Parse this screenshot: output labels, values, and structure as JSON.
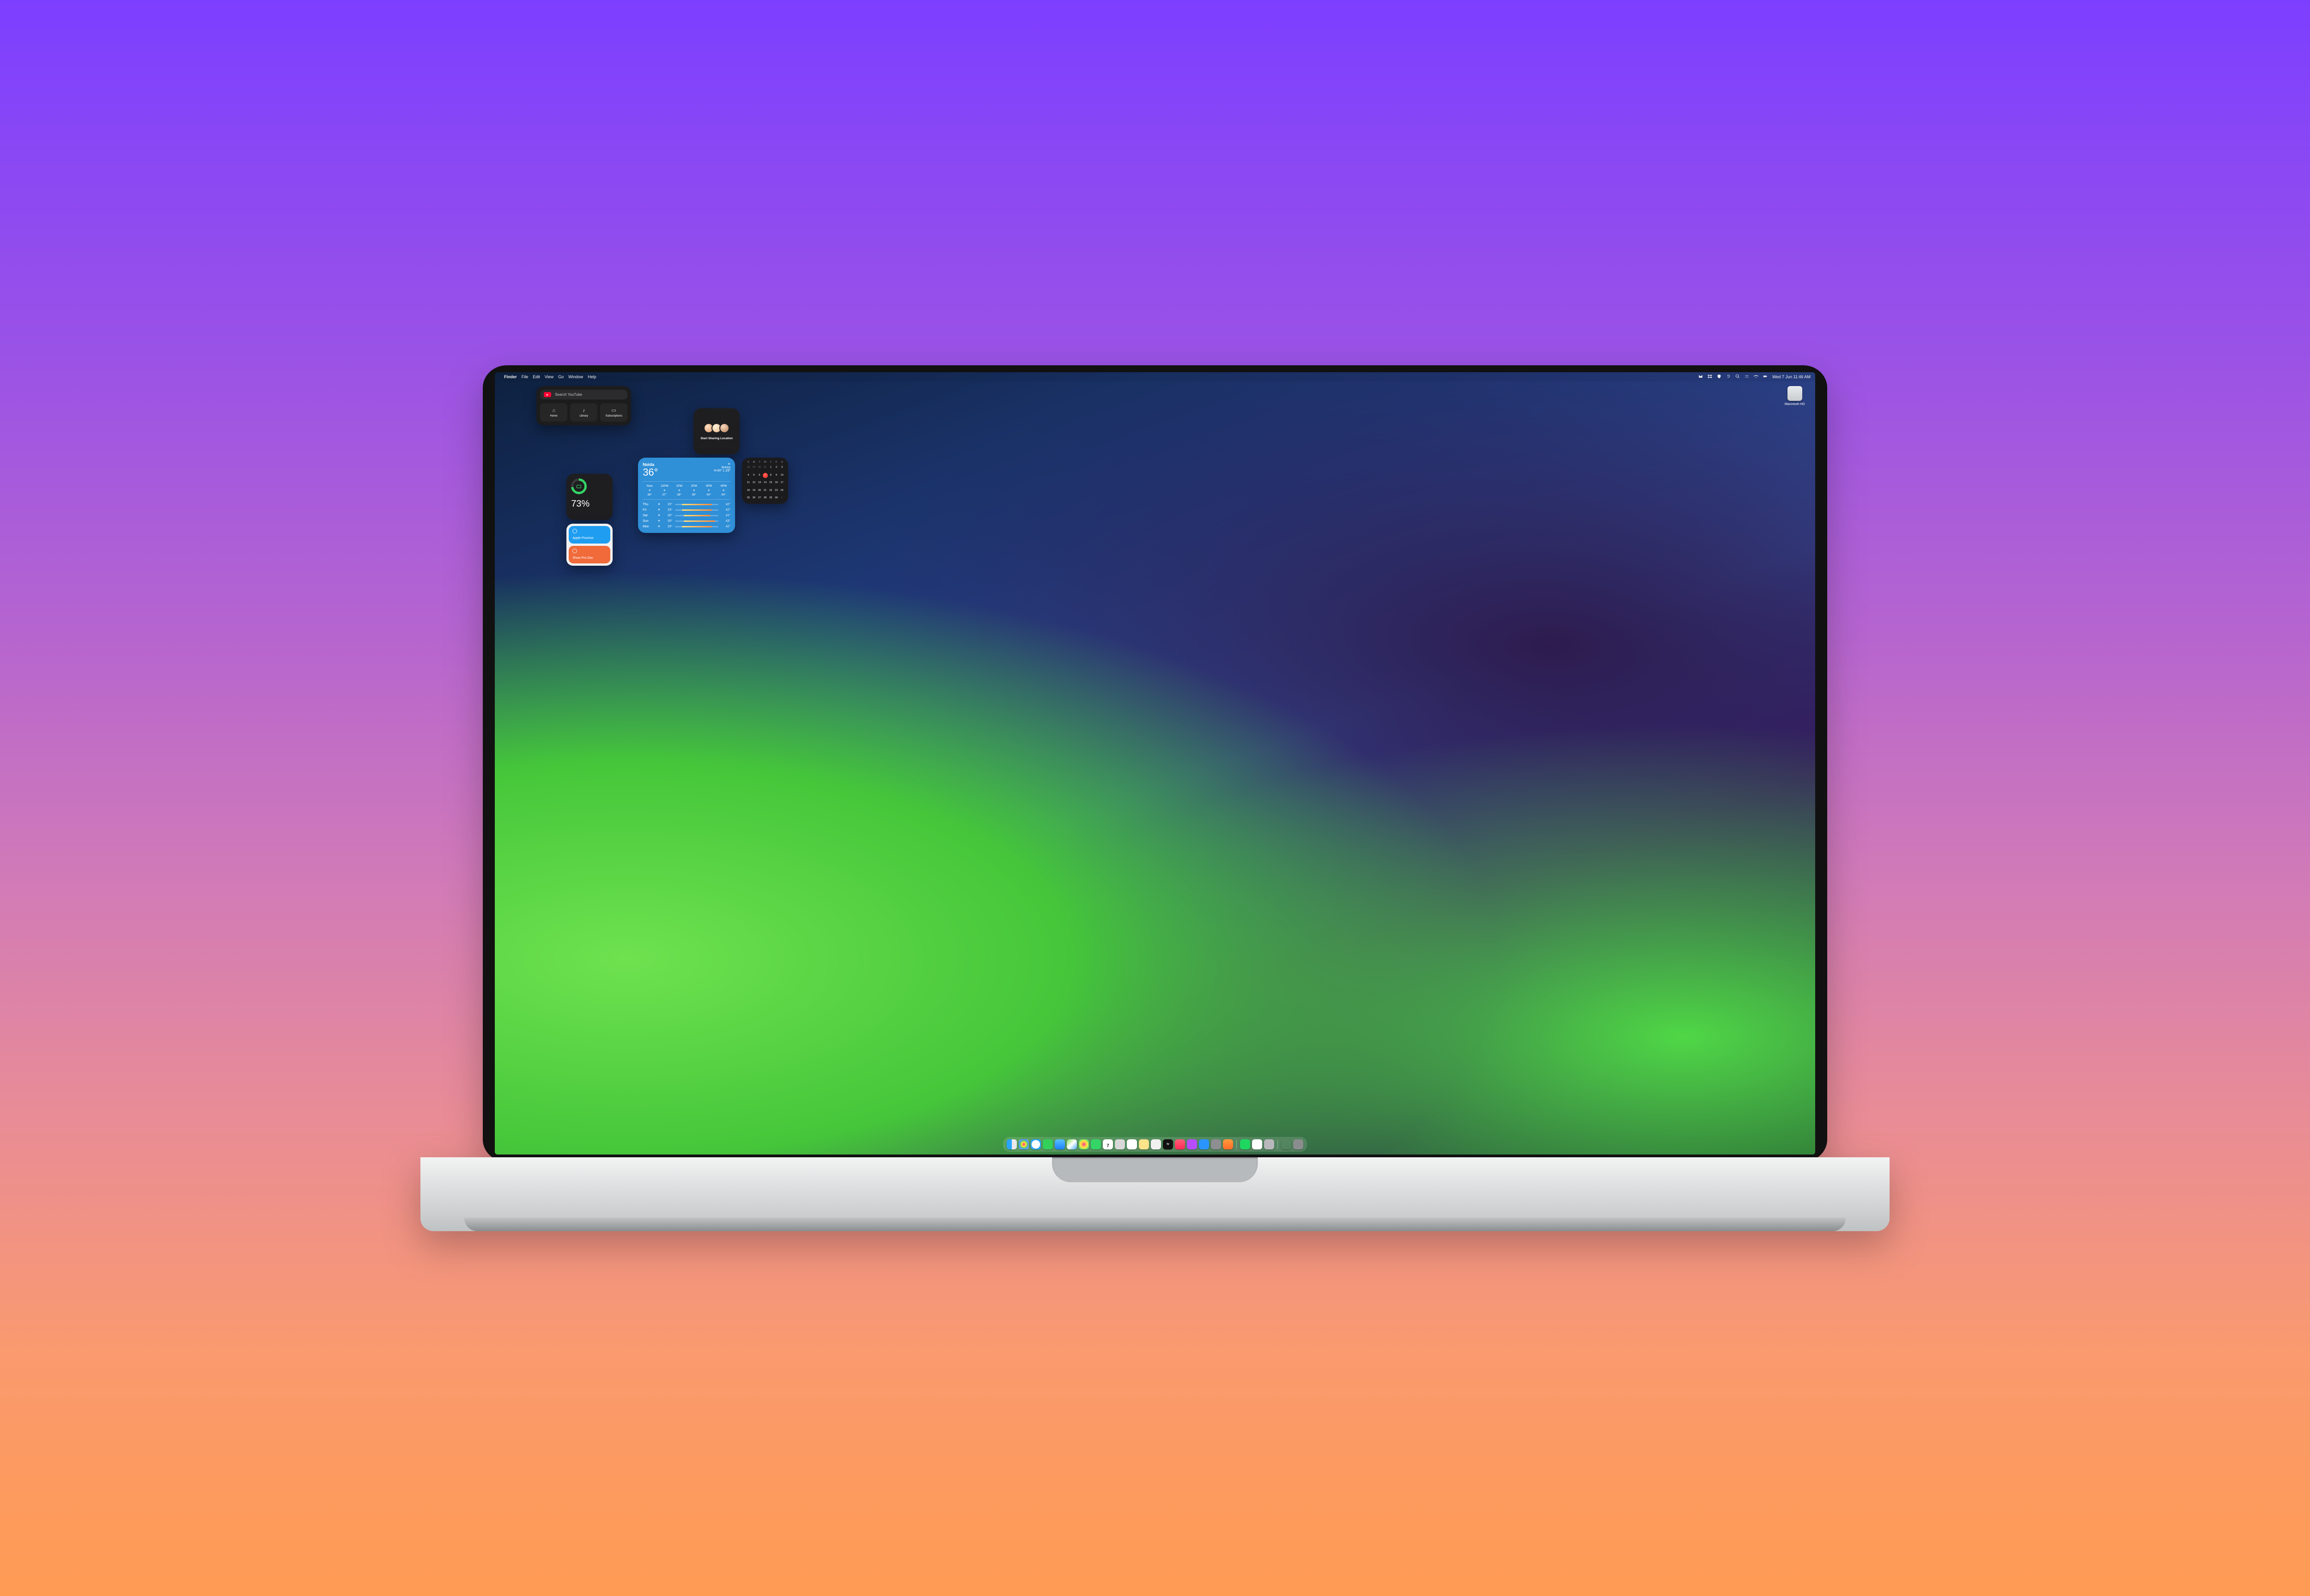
{
  "menubar": {
    "apple": "",
    "app": "Finder",
    "items": [
      "File",
      "Edit",
      "View",
      "Go",
      "Window",
      "Help"
    ],
    "right_icons": [
      "mail-icon",
      "dropbox-icon",
      "shield-icon",
      "sync-icon",
      "search-icon",
      "control-center-icon",
      "wifi-icon",
      "battery-icon"
    ],
    "clock": "Wed 7 Jun  11:46 AM"
  },
  "disk": {
    "name": "Macintosh HD"
  },
  "youtube": {
    "placeholder": "Search YouTube",
    "tiles": [
      {
        "icon": "home-icon",
        "label": "Home"
      },
      {
        "icon": "library-icon",
        "label": "Library"
      },
      {
        "icon": "subs-icon",
        "label": "Subscriptions"
      }
    ]
  },
  "findmy": {
    "label": "Start Sharing Location"
  },
  "battery": {
    "percent": "73%",
    "ring_pct": 73
  },
  "reminders": [
    {
      "color": "c-blue",
      "title": "Apple Promise"
    },
    {
      "color": "c-orange",
      "title": "Show Pro Doc"
    }
  ],
  "weather": {
    "city": "Noida",
    "temp": "36°",
    "cond": "Sunny",
    "hilo": "H:40° L:29°",
    "hourly": [
      {
        "t": "Now",
        "temp": "36°"
      },
      {
        "t": "12PM",
        "temp": "37°"
      },
      {
        "t": "1PM",
        "temp": "38°"
      },
      {
        "t": "2PM",
        "temp": "39°"
      },
      {
        "t": "3PM",
        "temp": "40°"
      },
      {
        "t": "4PM",
        "temp": "40°"
      }
    ],
    "daily": [
      {
        "d": "Thu",
        "lo": "29°",
        "hi": "42°",
        "l": 15,
        "w": 70
      },
      {
        "d": "Fri",
        "lo": "29°",
        "hi": "42°",
        "l": 15,
        "w": 70
      },
      {
        "d": "Sat",
        "lo": "30°",
        "hi": "41°",
        "l": 20,
        "w": 62
      },
      {
        "d": "Sun",
        "lo": "30°",
        "hi": "43°",
        "l": 20,
        "w": 72
      },
      {
        "d": "Mon",
        "lo": "29°",
        "hi": "42°",
        "l": 15,
        "w": 70
      }
    ]
  },
  "calendar": {
    "dow": [
      "S",
      "M",
      "T",
      "W",
      "T",
      "F",
      "S"
    ],
    "today": 7,
    "days": [
      [
        28,
        29,
        30,
        31,
        1,
        2,
        3
      ],
      [
        4,
        5,
        6,
        7,
        8,
        9,
        10
      ],
      [
        11,
        12,
        13,
        14,
        15,
        16,
        17
      ],
      [
        18,
        19,
        20,
        21,
        22,
        23,
        24
      ],
      [
        25,
        26,
        27,
        28,
        29,
        30,
        1
      ]
    ],
    "outside_first_row": 4,
    "outside_last_row_from": 6
  },
  "dock": {
    "apps": [
      {
        "n": "finder",
        "cls": "finder"
      },
      {
        "n": "launchpad",
        "cls": "launchpad"
      },
      {
        "n": "safari",
        "cls": "safari"
      },
      {
        "n": "messages",
        "cls": "messages"
      },
      {
        "n": "mail",
        "cls": "mail"
      },
      {
        "n": "maps",
        "cls": "maps"
      },
      {
        "n": "photos",
        "cls": "photos"
      },
      {
        "n": "facetime",
        "cls": "facetime"
      },
      {
        "n": "calendar",
        "cls": "calendar-app"
      },
      {
        "n": "contacts",
        "cls": "contacts"
      },
      {
        "n": "reminders",
        "cls": "reminders-app"
      },
      {
        "n": "notes",
        "cls": "notes"
      },
      {
        "n": "freeform",
        "cls": "freeform"
      },
      {
        "n": "tv",
        "cls": "tv",
        "txt": "tv"
      },
      {
        "n": "music",
        "cls": "music"
      },
      {
        "n": "podcasts",
        "cls": "podcasts"
      },
      {
        "n": "appstore",
        "cls": "appstore"
      },
      {
        "n": "system-settings",
        "cls": "sysset"
      },
      {
        "n": "home",
        "cls": "home"
      },
      {
        "n": "sep",
        "cls": "sep"
      },
      {
        "n": "spotify",
        "cls": "spotify"
      },
      {
        "n": "slack",
        "cls": "slack"
      },
      {
        "n": "preview",
        "cls": "finder2"
      },
      {
        "n": "sep",
        "cls": "sep"
      },
      {
        "n": "wand",
        "cls": "wand"
      },
      {
        "n": "trash",
        "cls": "trash"
      }
    ]
  }
}
